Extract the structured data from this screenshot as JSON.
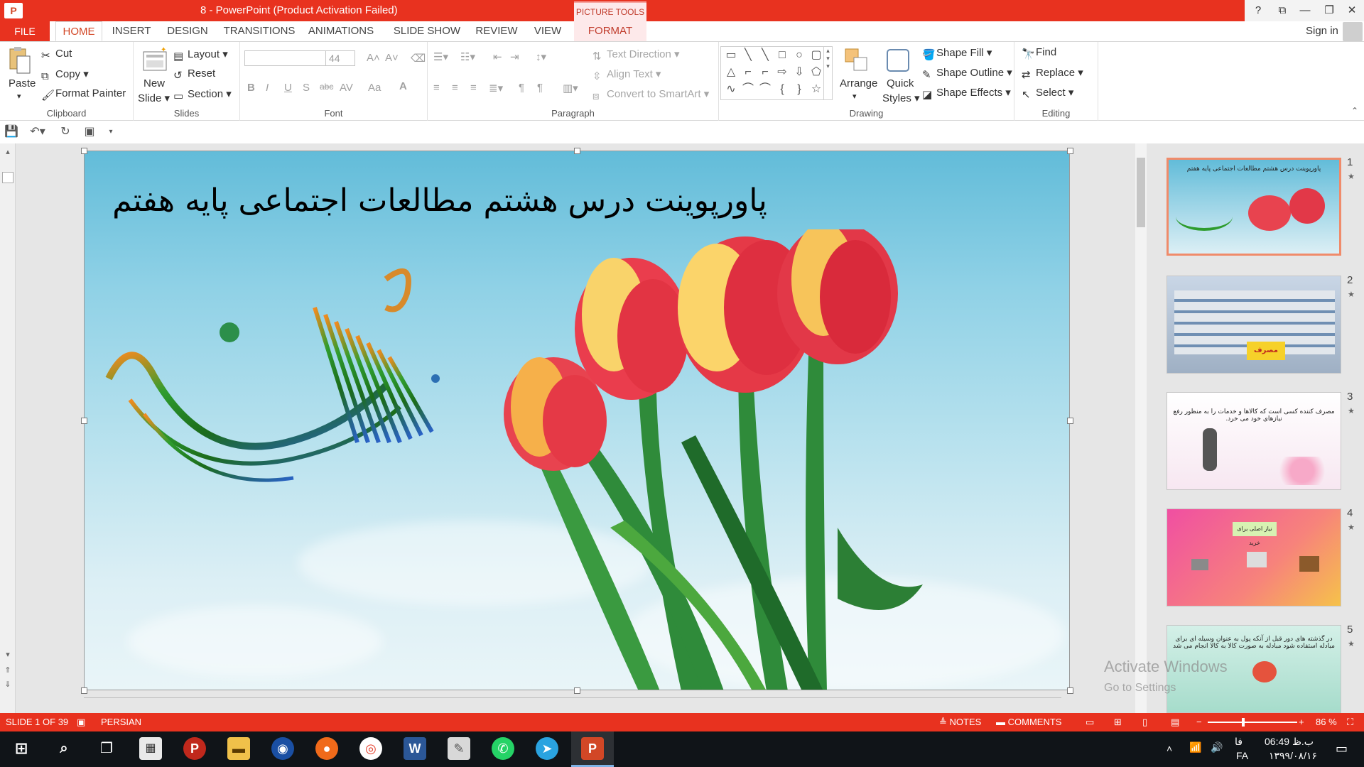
{
  "window": {
    "title": "8 - PowerPoint (Product Activation Failed)",
    "picture_tools": "PICTURE TOOLS",
    "help": "?",
    "restore_ribbon": "⧉",
    "minimize": "—",
    "maximize": "❐",
    "close": "✕"
  },
  "tabs": {
    "file": "FILE",
    "items": [
      "HOME",
      "INSERT",
      "DESIGN",
      "TRANSITIONS",
      "ANIMATIONS",
      "SLIDE SHOW",
      "REVIEW",
      "VIEW",
      "FORMAT"
    ],
    "active": "HOME",
    "sign_in": "Sign in"
  },
  "ribbon": {
    "clipboard": {
      "label": "Clipboard",
      "paste": "Paste",
      "cut": "Cut",
      "copy": "Copy",
      "format_painter": "Format Painter"
    },
    "slides": {
      "label": "Slides",
      "new_slide_1": "New",
      "new_slide_2": "Slide",
      "layout": "Layout",
      "reset": "Reset",
      "section": "Section"
    },
    "font": {
      "label": "Font",
      "font_name": "",
      "font_size": "44",
      "bold": "B",
      "italic": "I",
      "underline": "U",
      "shadow": "S",
      "strikethrough": "abc",
      "spacing": "AV",
      "case": "Aa",
      "color": "A"
    },
    "paragraph": {
      "label": "Paragraph",
      "text_direction": "Text Direction",
      "align_text": "Align Text",
      "convert_smartart": "Convert to SmartArt"
    },
    "drawing": {
      "label": "Drawing",
      "arrange": "Arrange",
      "quick_styles_1": "Quick",
      "quick_styles_2": "Styles",
      "shape_fill": "Shape Fill",
      "shape_outline": "Shape Outline",
      "shape_effects": "Shape Effects"
    },
    "editing": {
      "label": "Editing",
      "find": "Find",
      "replace": "Replace",
      "select": "Select"
    }
  },
  "slide": {
    "title": "پاورپوینت درس هشتم مطالعات اجتماعی پایه هفتم"
  },
  "thumbnails": [
    {
      "number": "1",
      "text": "پاورپوینت درس هشتم مطالعات اجتماعی پایه هفتم"
    },
    {
      "number": "2",
      "text": "مصرف"
    },
    {
      "number": "3",
      "text": "مصرف کننده کسی است که کالاها و خدمات را به منظور رفع نیازهای خود می خرد."
    },
    {
      "number": "4",
      "text": "نیاز اصلی برای خرید"
    },
    {
      "number": "5",
      "text": "در گذشته های دور قبل از آنکه پول به عنوان وسیله ای برای مبادله استفاده شود مبادله به صورت کالا به کالا انجام می شد"
    }
  ],
  "watermark": {
    "line1": "Activate Windows",
    "line2": "Go to Settings"
  },
  "status": {
    "slide_info": "SLIDE 1 OF 39",
    "language": "PERSIAN",
    "notes": "NOTES",
    "comments": "COMMENTS",
    "zoom": "86 %"
  },
  "taskbar": {
    "time": "06:49 ب.ظ",
    "date": "۱۳۹۹/۰۸/۱۶",
    "lang_top": "فا",
    "lang_bottom": "FA"
  },
  "colors": {
    "accent": "#e8321f",
    "active_tab": "#d24726",
    "format_tab_bg": "#fde9ea"
  }
}
